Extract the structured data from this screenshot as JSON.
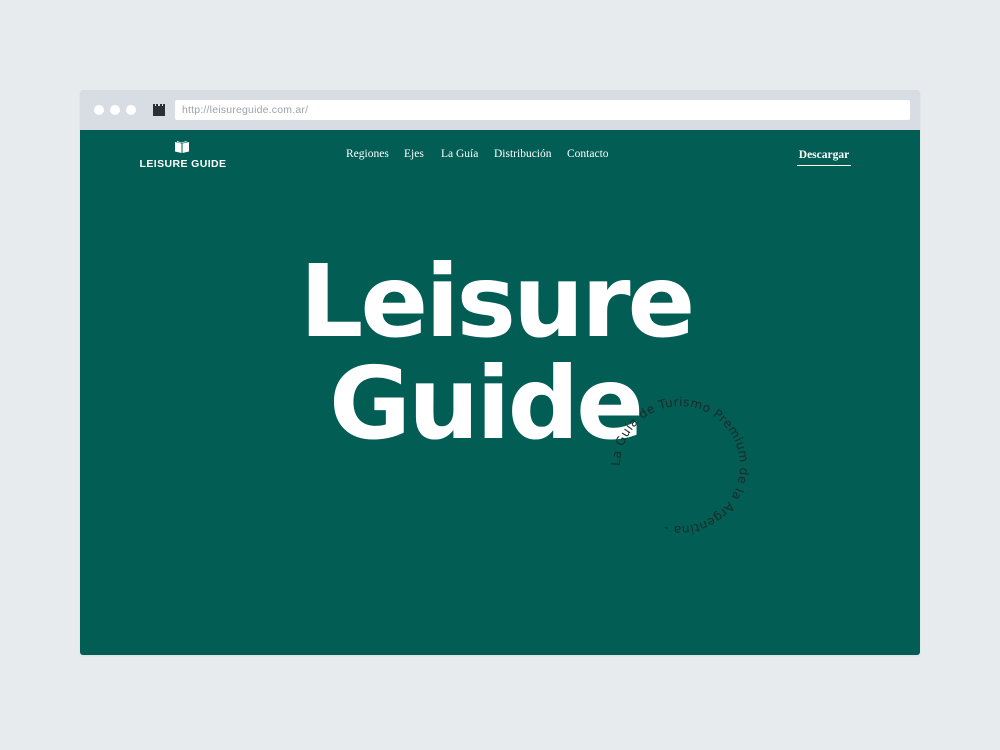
{
  "browser": {
    "url": "http://leisureguide.com.ar/",
    "controls": [
      "close-dot",
      "minimize-dot",
      "maximize-dot"
    ]
  },
  "site": {
    "brand": "LEISURE GUIDE",
    "logo_icon": "book-icon",
    "nav": [
      {
        "label": "Regiones"
      },
      {
        "label": "Ejes"
      },
      {
        "label": "La Guía"
      },
      {
        "label": "Distribución"
      },
      {
        "label": "Contacto"
      }
    ],
    "download_label": "Descargar",
    "hero": {
      "line1": "Leisure",
      "line2": "Guide"
    },
    "badge_text": "La Guía de Turismo Premium de la Argentina - ",
    "colors": {
      "background": "#025d55",
      "text": "#ffffff",
      "badge_text": "#1c2a28",
      "page_bg": "#e8ebee",
      "chrome": "#d7dde3"
    }
  }
}
